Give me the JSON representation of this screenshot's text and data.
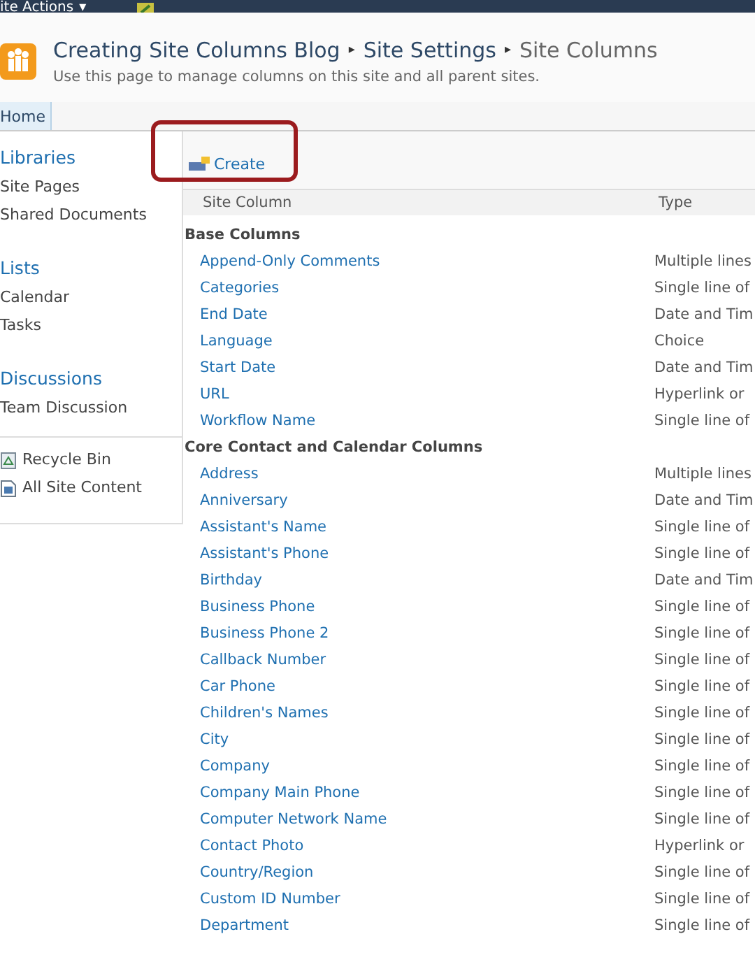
{
  "top_bar": {
    "menu": "ite Actions",
    "caret": "▾"
  },
  "header": {
    "breadcrumb": [
      "Creating Site Columns Blog",
      "Site Settings",
      "Site Columns"
    ],
    "separator": "▸",
    "description": "Use this page to manage columns on this site and all parent sites."
  },
  "tabs": [
    {
      "label": "Home",
      "selected": true
    }
  ],
  "sidebar": {
    "sections": [
      {
        "heading": "Libraries",
        "items": [
          "Site Pages",
          "Shared Documents"
        ]
      },
      {
        "heading": "Lists",
        "items": [
          "Calendar",
          "Tasks"
        ]
      },
      {
        "heading": "Discussions",
        "items": [
          "Team Discussion"
        ]
      }
    ],
    "footer_items": [
      {
        "label": "Recycle Bin",
        "kind": "recycle"
      },
      {
        "label": "All Site Content",
        "kind": "content"
      }
    ]
  },
  "toolbar": {
    "create": "Create"
  },
  "table": {
    "columns": [
      "Site Column",
      "Type"
    ],
    "groups": [
      {
        "name": "Base Columns",
        "rows": [
          {
            "name": "Append-Only Comments",
            "type": "Multiple lines"
          },
          {
            "name": "Categories",
            "type": "Single line of"
          },
          {
            "name": "End Date",
            "type": "Date and Tim"
          },
          {
            "name": "Language",
            "type": "Choice"
          },
          {
            "name": "Start Date",
            "type": "Date and Tim"
          },
          {
            "name": "URL",
            "type": "Hyperlink or"
          },
          {
            "name": "Workflow Name",
            "type": "Single line of"
          }
        ]
      },
      {
        "name": "Core Contact and Calendar Columns",
        "rows": [
          {
            "name": "Address",
            "type": "Multiple lines"
          },
          {
            "name": "Anniversary",
            "type": "Date and Tim"
          },
          {
            "name": "Assistant's Name",
            "type": "Single line of"
          },
          {
            "name": "Assistant's Phone",
            "type": "Single line of"
          },
          {
            "name": "Birthday",
            "type": "Date and Tim"
          },
          {
            "name": "Business Phone",
            "type": "Single line of"
          },
          {
            "name": "Business Phone 2",
            "type": "Single line of"
          },
          {
            "name": "Callback Number",
            "type": "Single line of"
          },
          {
            "name": "Car Phone",
            "type": "Single line of"
          },
          {
            "name": "Children's Names",
            "type": "Single line of"
          },
          {
            "name": "City",
            "type": "Single line of"
          },
          {
            "name": "Company",
            "type": "Single line of"
          },
          {
            "name": "Company Main Phone",
            "type": "Single line of"
          },
          {
            "name": "Computer Network Name",
            "type": "Single line of"
          },
          {
            "name": "Contact Photo",
            "type": "Hyperlink or"
          },
          {
            "name": "Country/Region",
            "type": "Single line of"
          },
          {
            "name": "Custom ID Number",
            "type": "Single line of"
          },
          {
            "name": "Department",
            "type": "Single line of"
          }
        ]
      }
    ]
  }
}
